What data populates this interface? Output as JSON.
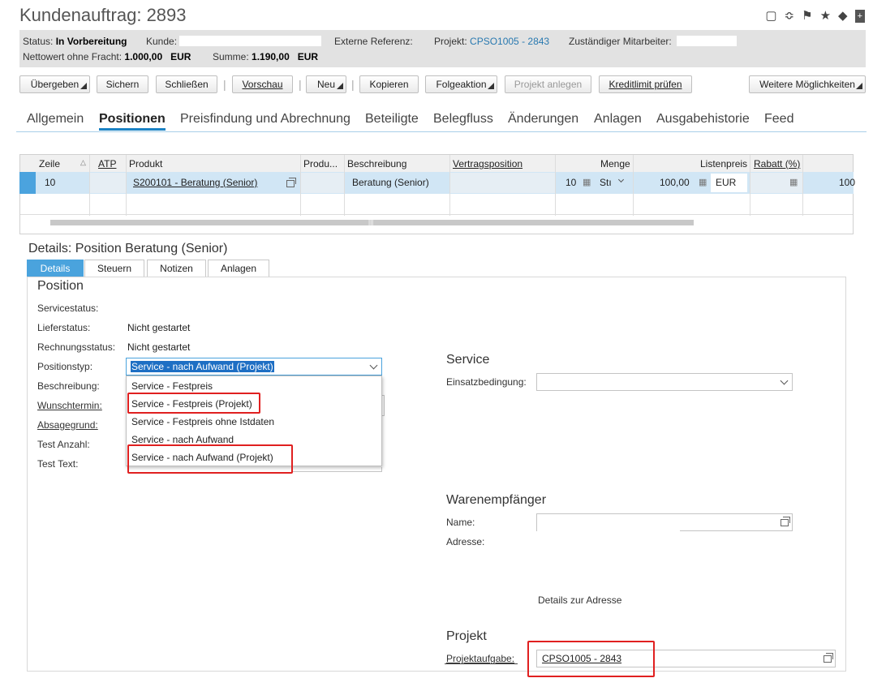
{
  "header": {
    "title": "Kundenauftrag: 2893",
    "icons": [
      "chat-icon",
      "rss-icon",
      "flag-icon",
      "star-icon",
      "tag-icon",
      "add-panel-icon"
    ]
  },
  "status": {
    "status_label": "Status:",
    "status_value": "In Vorbereitung",
    "kunde_label": "Kunde:",
    "ext_ref_label": "Externe Referenz:",
    "projekt_label": "Projekt:",
    "projekt_value": "CPSO1005 - 2843",
    "mitarbeiter_label": "Zuständiger Mitarbeiter:",
    "netto_label": "Nettowert ohne Fracht:",
    "netto_value": "1.000,00",
    "netto_currency": "EUR",
    "summe_label": "Summe:",
    "summe_value": "1.190,00",
    "summe_currency": "EUR"
  },
  "toolbar": {
    "uebergeben": "Übergeben",
    "sichern": "Sichern",
    "schliessen": "Schließen",
    "vorschau": "Vorschau",
    "neu": "Neu",
    "kopieren": "Kopieren",
    "folgeaktion": "Folgeaktion",
    "projekt_anlegen": "Projekt anlegen",
    "kreditlimit": "Kreditlimit prüfen",
    "weitere": "Weitere Möglichkeiten"
  },
  "tabs": [
    "Allgemein",
    "Positionen",
    "Preisfindung und Abrechnung",
    "Beteiligte",
    "Belegfluss",
    "Änderungen",
    "Anlagen",
    "Ausgabehistorie",
    "Feed"
  ],
  "grid": {
    "headers": {
      "zeile": "Zeile",
      "atp": "ATP",
      "produkt": "Produkt",
      "produ": "Produ...",
      "beschreibung": "Beschreibung",
      "vertragsposition": "Vertragsposition",
      "menge": "Menge",
      "listenpreis": "Listenpreis",
      "rabatt": "Rabatt (%)"
    },
    "row": {
      "zeile": "10",
      "produkt": "S200101 - Beratung (Senior)",
      "beschreibung": "Beratung (Senior)",
      "menge": "10",
      "einheit": "Stı",
      "listenpreis": "100,00",
      "waehrung": "EUR",
      "rest": "100"
    }
  },
  "details": {
    "title": "Details: Position Beratung (Senior)",
    "subtabs": [
      "Details",
      "Steuern",
      "Notizen",
      "Anlagen"
    ],
    "position": {
      "heading": "Position",
      "servicestatus_label": "Servicestatus:",
      "lieferstatus_label": "Lieferstatus:",
      "lieferstatus_value": "Nicht gestartet",
      "rechnungsstatus_label": "Rechnungsstatus:",
      "rechnungsstatus_value": "Nicht gestartet",
      "positionstyp_label": "Positionstyp:",
      "positionstyp_value": "Service - nach Aufwand (Projekt)",
      "beschreibung_label": "Beschreibung:",
      "wunschtermin_label": "Wunschtermin:",
      "absagegrund_label": "Absagegrund:",
      "test_anzahl_label": "Test Anzahl:",
      "test_text_label": "Test Text:"
    },
    "positionstyp_options": [
      "Service - Festpreis",
      "Service - Festpreis (Projekt)",
      "Service - Festpreis ohne Istdaten",
      "Service - nach Aufwand",
      "Service - nach Aufwand (Projekt)"
    ],
    "service": {
      "heading": "Service",
      "einsatz_label": "Einsatzbedingung:",
      "einsatz_value": ""
    },
    "waren": {
      "heading": "Warenempfänger",
      "name_label": "Name:",
      "adresse_label": "Adresse:",
      "details_link": "Details zur Adresse"
    },
    "projekt": {
      "heading": "Projekt",
      "aufgabe_label": "Projektaufgabe:",
      "aufgabe_value": "CPSO1005 - 2843"
    }
  },
  "colors": {
    "accent": "#1a82c4",
    "selected_row": "#d1e6f5",
    "highlight": "#e02020",
    "link": "#2979b0"
  }
}
